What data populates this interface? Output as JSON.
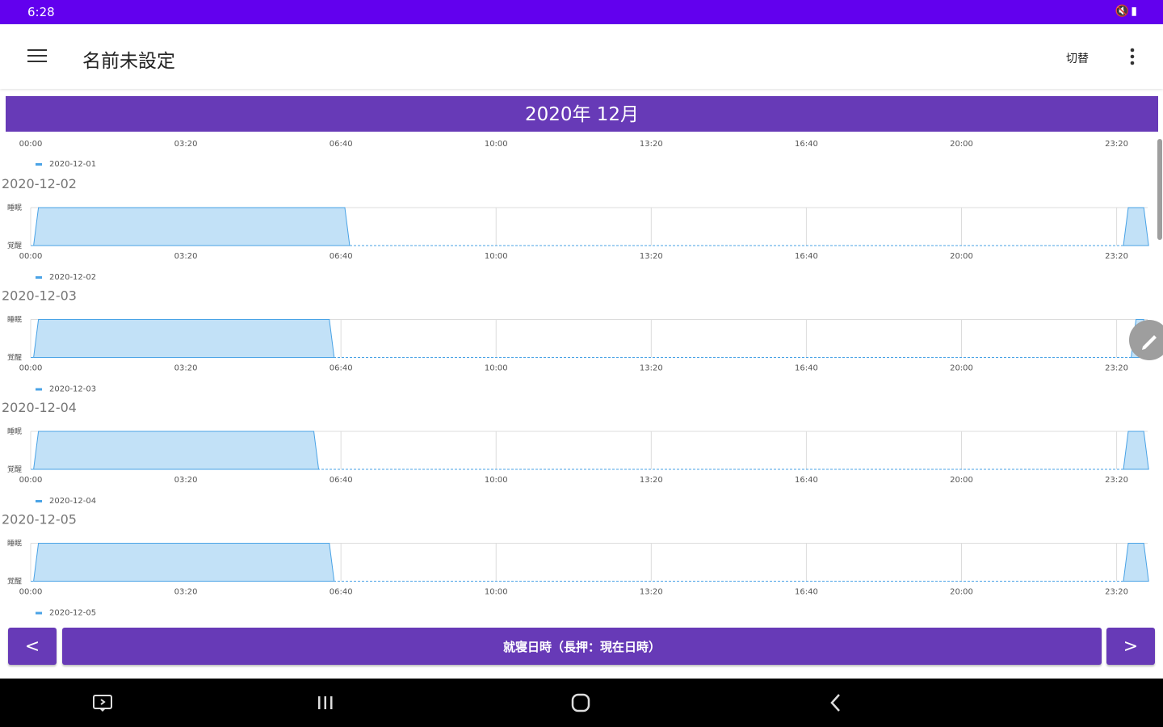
{
  "status_bar": {
    "time": "6:28",
    "right_icons": [
      "mute-icon",
      "battery-icon"
    ]
  },
  "app_bar": {
    "title": "名前未設定",
    "switch_label": "切替"
  },
  "month_header": "2020年 12月",
  "nav": {
    "prev_label": "<",
    "next_label": ">",
    "main_label": "就寝日時（長押：現在日時）"
  },
  "chart_data": [
    {
      "type": "area",
      "title": "",
      "legend": "2020-12-01",
      "x_ticks": [
        "00:00",
        "03:20",
        "06:40",
        "10:00",
        "13:20",
        "16:40",
        "20:00",
        "23:20"
      ],
      "segments": []
    },
    {
      "type": "area",
      "title": "2020-12-02",
      "legend": "2020-12-02",
      "y_labels": [
        "睡眠",
        "覚醒"
      ],
      "x_ticks": [
        "00:00",
        "03:20",
        "06:40",
        "10:00",
        "13:20",
        "16:40",
        "20:00",
        "23:20"
      ],
      "segments": [
        [
          "00:10",
          "06:45"
        ],
        [
          "23:35",
          "23:55"
        ]
      ]
    },
    {
      "type": "area",
      "title": "2020-12-03",
      "legend": "2020-12-03",
      "y_labels": [
        "睡眠",
        "覚醒"
      ],
      "x_ticks": [
        "00:00",
        "03:20",
        "06:40",
        "10:00",
        "13:20",
        "16:40",
        "20:00",
        "23:20"
      ],
      "segments": [
        [
          "00:10",
          "06:25"
        ],
        [
          "23:45",
          "23:55"
        ]
      ]
    },
    {
      "type": "area",
      "title": "2020-12-04",
      "legend": "2020-12-04",
      "y_labels": [
        "睡眠",
        "覚醒"
      ],
      "x_ticks": [
        "00:00",
        "03:20",
        "06:40",
        "10:00",
        "13:20",
        "16:40",
        "20:00",
        "23:20"
      ],
      "segments": [
        [
          "00:10",
          "06:05"
        ],
        [
          "23:35",
          "23:55"
        ]
      ]
    },
    {
      "type": "area",
      "title": "2020-12-05",
      "legend": "2020-12-05",
      "y_labels": [
        "睡眠",
        "覚醒"
      ],
      "x_ticks": [
        "00:00",
        "03:20",
        "06:40",
        "10:00",
        "13:20",
        "16:40",
        "20:00",
        "23:20"
      ],
      "segments": [
        [
          "00:10",
          "06:25"
        ],
        [
          "23:35",
          "23:55"
        ]
      ]
    }
  ],
  "colors": {
    "status_bar": "#6200ee",
    "banner": "#673ab7",
    "area_fill": "#c2e1f7",
    "area_line": "#4aa3e6",
    "grid": "#dcdcdc",
    "tick_text": "#555555",
    "label_text": "#777777"
  }
}
